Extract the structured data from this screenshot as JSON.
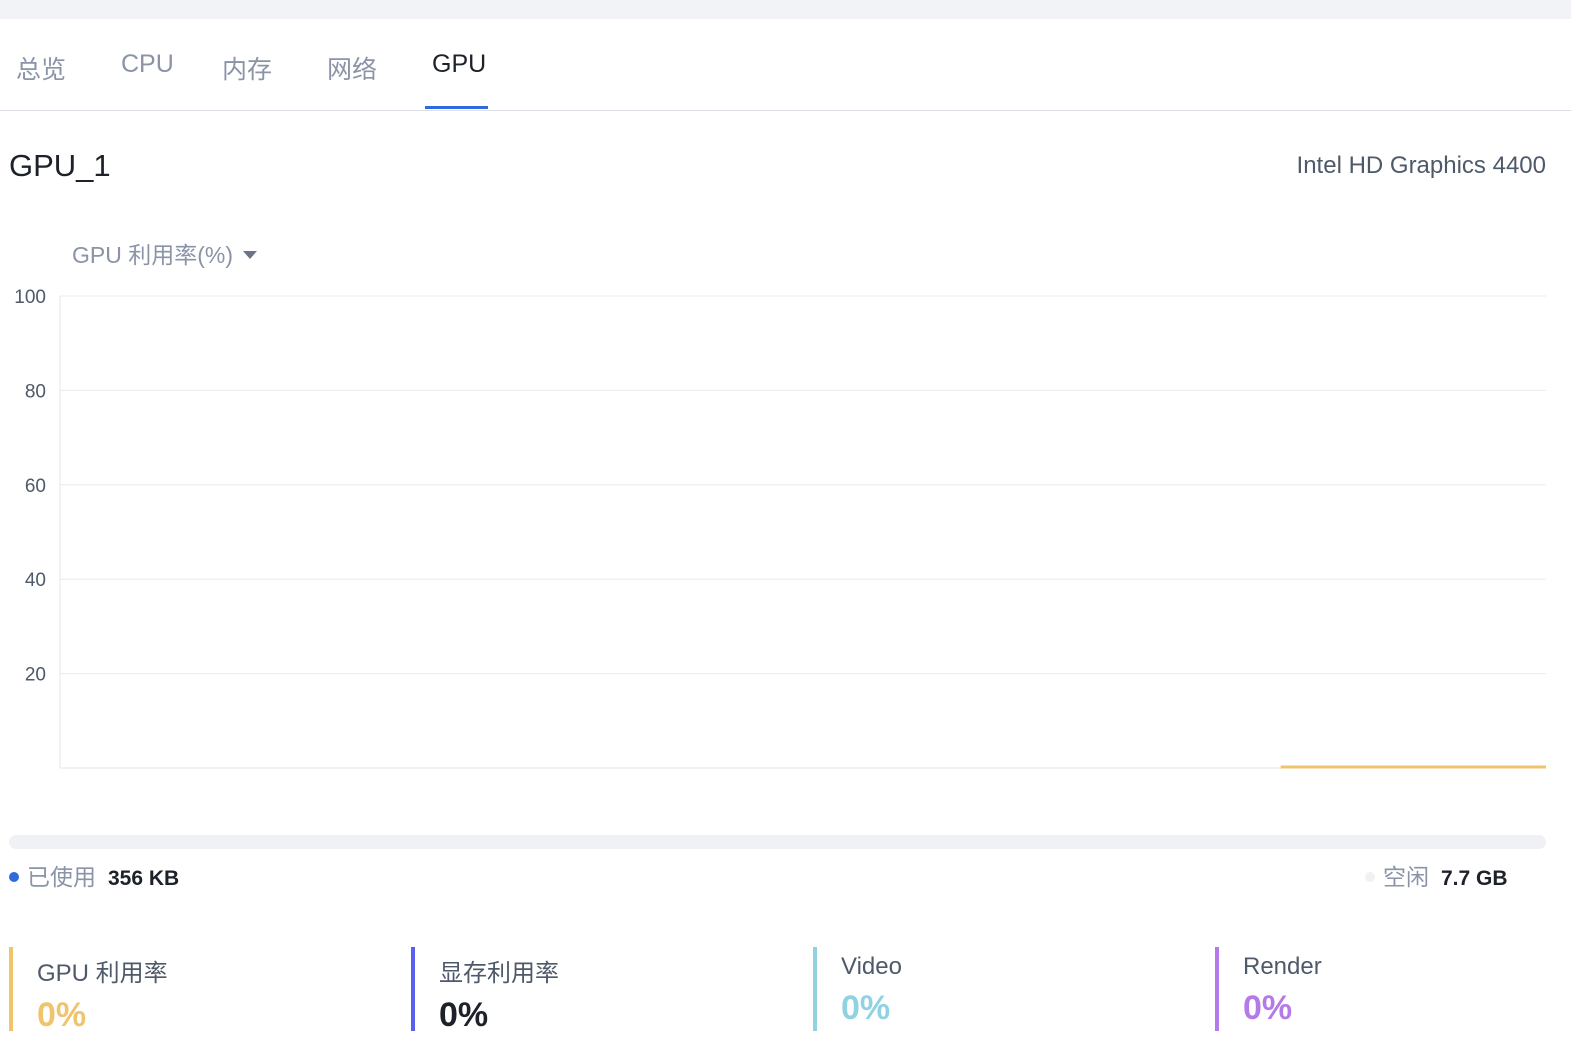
{
  "tabs": [
    {
      "label": "总览",
      "active": false
    },
    {
      "label": "CPU",
      "active": false
    },
    {
      "label": "内存",
      "active": false
    },
    {
      "label": "网络",
      "active": false
    },
    {
      "label": "GPU",
      "active": true
    }
  ],
  "gpu": {
    "name": "GPU_1",
    "model": "Intel HD Graphics 4400"
  },
  "metric_select": {
    "label": "GPU 利用率(%)",
    "icon": "caret-down-icon"
  },
  "chart_data": {
    "type": "line",
    "ylim": [
      0,
      100
    ],
    "yticks": [
      20,
      40,
      60,
      80,
      100
    ],
    "grid": true,
    "series": [
      {
        "color": "#f0c36d",
        "values": [
          null,
          null,
          null,
          null,
          null,
          null,
          null,
          null,
          null,
          null,
          null,
          null,
          null,
          null,
          null,
          null,
          null,
          null,
          null,
          null,
          null,
          null,
          null,
          null,
          null,
          null,
          null,
          null,
          null,
          null,
          null,
          null,
          null,
          null,
          null,
          null,
          null,
          null,
          null,
          null,
          null,
          null,
          null,
          null,
          null,
          null,
          0,
          0,
          0,
          0,
          0,
          0,
          0,
          0,
          0,
          0,
          0
        ]
      }
    ]
  },
  "memory": {
    "used_fraction": 5e-05,
    "used_label": "已使用",
    "used_value": "356 KB",
    "free_label": "空闲",
    "free_value": "7.7 GB",
    "used_color": "#2f6bd8",
    "free_color": "#eff1f4"
  },
  "stats": [
    {
      "label": "GPU 利用率",
      "value": "0%",
      "color": "#f0c36d"
    },
    {
      "label": "显存利用率",
      "value": "0%",
      "color": "#5b5ff0",
      "value_color": "#1d2129"
    },
    {
      "label": "Video",
      "value": "0%",
      "color": "#8fd3e3"
    },
    {
      "label": "Render",
      "value": "0%",
      "color": "#b47aea"
    }
  ]
}
